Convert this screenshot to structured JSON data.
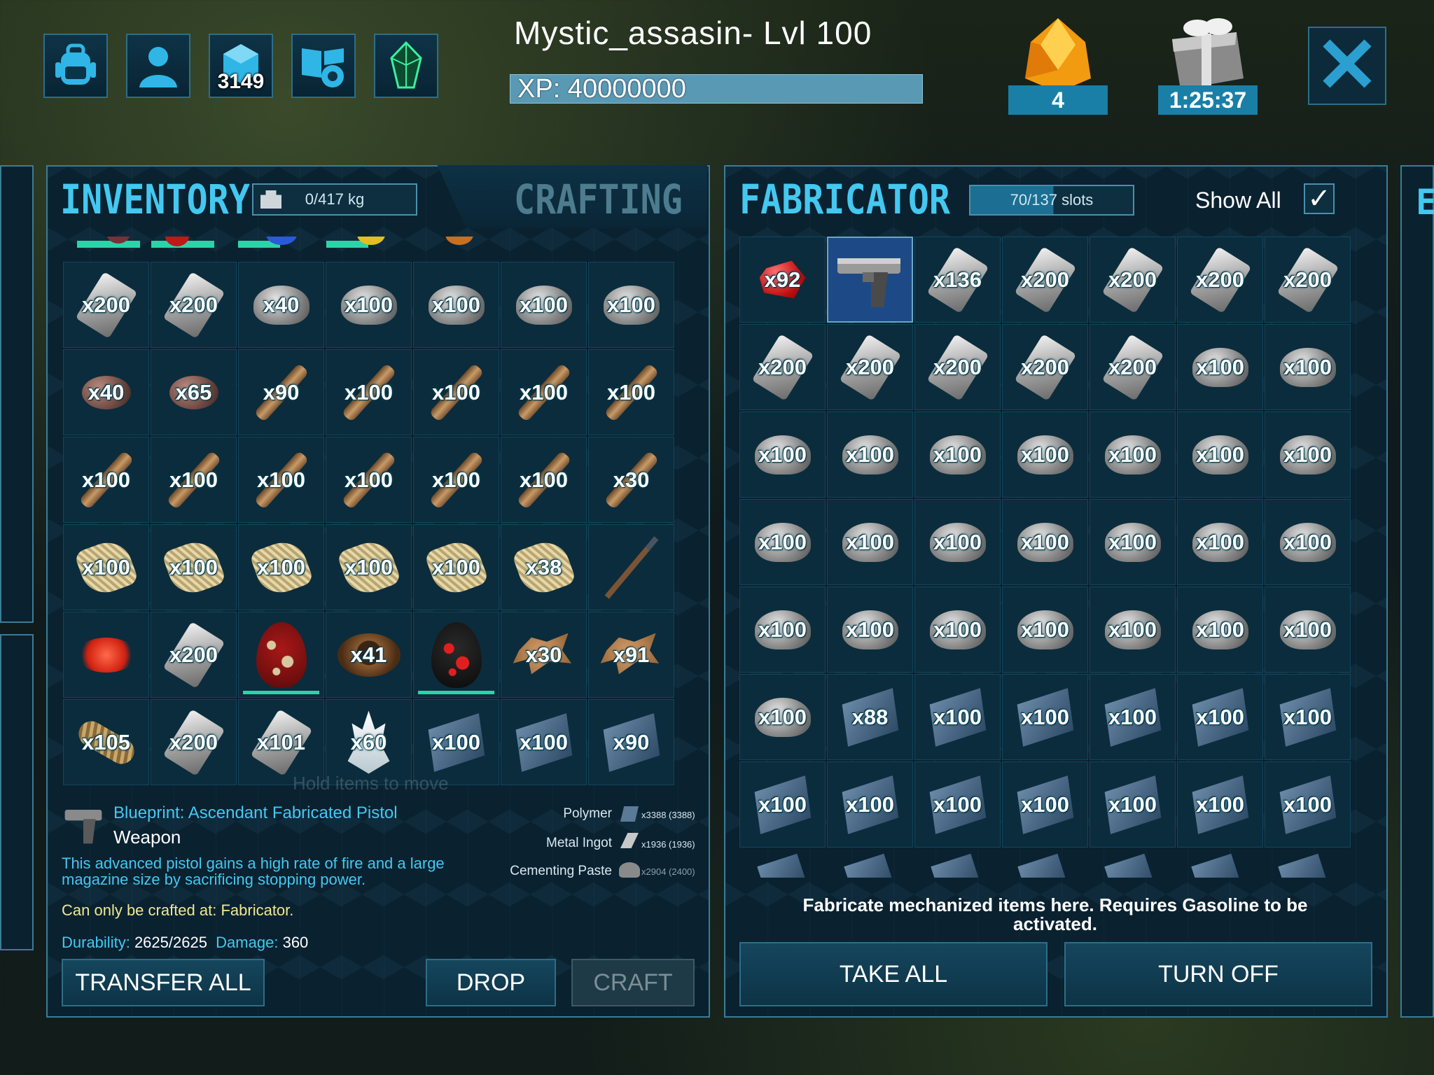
{
  "player": {
    "name": "Mystic_assasin- Lvl 100",
    "xp": "XP: 40000000"
  },
  "topbar": {
    "icons": [
      "backpack-icon",
      "character-icon",
      "engram-icon",
      "settings-book-icon",
      "tribe-crystal-icon"
    ],
    "engram_points": "3149",
    "resource_count": "4",
    "gift_timer": "1:25:37"
  },
  "inventory": {
    "title": "INVENTORY",
    "weight": "0/417 kg",
    "crafting_tab": "CRAFTING",
    "hint": "Hold items to move",
    "rows": [
      [
        {
          "k": "ingot",
          "q": "x200"
        },
        {
          "k": "ingot",
          "q": "x200"
        },
        {
          "k": "stone",
          "q": "x40"
        },
        {
          "k": "stone",
          "q": "x100"
        },
        {
          "k": "stone",
          "q": "x100"
        },
        {
          "k": "stone",
          "q": "x100"
        },
        {
          "k": "stone",
          "q": "x100"
        }
      ],
      [
        {
          "k": "flint",
          "q": "x40"
        },
        {
          "k": "flint",
          "q": "x65"
        },
        {
          "k": "wood",
          "q": "x90"
        },
        {
          "k": "wood",
          "q": "x100"
        },
        {
          "k": "wood",
          "q": "x100"
        },
        {
          "k": "wood",
          "q": "x100"
        },
        {
          "k": "wood",
          "q": "x100"
        }
      ],
      [
        {
          "k": "wood",
          "q": "x100"
        },
        {
          "k": "wood",
          "q": "x100"
        },
        {
          "k": "wood",
          "q": "x100"
        },
        {
          "k": "wood",
          "q": "x100"
        },
        {
          "k": "wood",
          "q": "x100"
        },
        {
          "k": "wood",
          "q": "x100"
        },
        {
          "k": "wood",
          "q": "x30"
        }
      ],
      [
        {
          "k": "thatch",
          "q": "x100"
        },
        {
          "k": "thatch",
          "q": "x100"
        },
        {
          "k": "thatch",
          "q": "x100"
        },
        {
          "k": "thatch",
          "q": "x100"
        },
        {
          "k": "thatch",
          "q": "x100"
        },
        {
          "k": "thatch",
          "q": "x38"
        },
        {
          "k": "spear",
          "q": ""
        }
      ],
      [
        {
          "k": "powder",
          "q": ""
        },
        {
          "k": "ingot",
          "q": "x200"
        },
        {
          "k": "egg",
          "q": "",
          "bar": true
        },
        {
          "k": "bowl",
          "q": "x41"
        },
        {
          "k": "egg2",
          "q": "",
          "bar": true
        },
        {
          "k": "hide",
          "q": "x30"
        },
        {
          "k": "hide",
          "q": "x91"
        }
      ],
      [
        {
          "k": "fiber",
          "q": "x105"
        },
        {
          "k": "ingot",
          "q": "x200"
        },
        {
          "k": "ingot",
          "q": "x101"
        },
        {
          "k": "crystal",
          "q": "x60"
        },
        {
          "k": "plate",
          "q": "x100"
        },
        {
          "k": "plate",
          "q": "x100"
        },
        {
          "k": "plate",
          "q": "x90"
        }
      ]
    ]
  },
  "item_detail": {
    "name": "Blueprint: Ascendant Fabricated Pistol",
    "type": "Weapon",
    "description": "This advanced pistol gains a high rate of fire and a large magazine size by sacrificing stopping power.",
    "crafted_at": "Can only be crafted at: Fabricator.",
    "durability_label": "Durability:",
    "durability": "2625/2625",
    "damage_label": "Damage:",
    "damage": "360",
    "requirements": [
      {
        "name": "Polymer",
        "amount": "x3388 (3388)"
      },
      {
        "name": "Metal Ingot",
        "amount": "x1936 (1936)"
      },
      {
        "name": "Cementing Paste",
        "amount": "x2904 (2400)"
      }
    ]
  },
  "inventory_buttons": {
    "transfer_all": "TRANSFER ALL",
    "drop": "DROP",
    "craft": "CRAFT"
  },
  "fabricator": {
    "title": "FABRICATOR",
    "slots": "70/137 slots",
    "show_all": "Show All",
    "show_all_checked": "✓",
    "info": "Fabricate mechanized items here. Requires Gasoline to be activated.",
    "take_all": "TAKE ALL",
    "turn_off": "TURN OFF",
    "rows": [
      [
        {
          "k": "gem-red",
          "q": "x92"
        },
        {
          "k": "pistol",
          "q": "",
          "sel": true
        },
        {
          "k": "ingot",
          "q": "x136"
        },
        {
          "k": "ingot",
          "q": "x200"
        },
        {
          "k": "ingot",
          "q": "x200"
        },
        {
          "k": "ingot",
          "q": "x200"
        },
        {
          "k": "ingot",
          "q": "x200"
        }
      ],
      [
        {
          "k": "ingot",
          "q": "x200"
        },
        {
          "k": "ingot",
          "q": "x200"
        },
        {
          "k": "ingot",
          "q": "x200"
        },
        {
          "k": "ingot",
          "q": "x200"
        },
        {
          "k": "ingot",
          "q": "x200"
        },
        {
          "k": "stone",
          "q": "x100"
        },
        {
          "k": "stone",
          "q": "x100"
        }
      ],
      [
        {
          "k": "stone",
          "q": "x100"
        },
        {
          "k": "stone",
          "q": "x100"
        },
        {
          "k": "stone",
          "q": "x100"
        },
        {
          "k": "stone",
          "q": "x100"
        },
        {
          "k": "stone",
          "q": "x100"
        },
        {
          "k": "stone",
          "q": "x100"
        },
        {
          "k": "stone",
          "q": "x100"
        }
      ],
      [
        {
          "k": "stone",
          "q": "x100"
        },
        {
          "k": "stone",
          "q": "x100"
        },
        {
          "k": "stone",
          "q": "x100"
        },
        {
          "k": "stone",
          "q": "x100"
        },
        {
          "k": "stone",
          "q": "x100"
        },
        {
          "k": "stone",
          "q": "x100"
        },
        {
          "k": "stone",
          "q": "x100"
        }
      ],
      [
        {
          "k": "stone",
          "q": "x100"
        },
        {
          "k": "stone",
          "q": "x100"
        },
        {
          "k": "stone",
          "q": "x100"
        },
        {
          "k": "stone",
          "q": "x100"
        },
        {
          "k": "stone",
          "q": "x100"
        },
        {
          "k": "stone",
          "q": "x100"
        },
        {
          "k": "stone",
          "q": "x100"
        }
      ],
      [
        {
          "k": "stone",
          "q": "x100"
        },
        {
          "k": "plate",
          "q": "x88"
        },
        {
          "k": "plate",
          "q": "x100"
        },
        {
          "k": "plate",
          "q": "x100"
        },
        {
          "k": "plate",
          "q": "x100"
        },
        {
          "k": "plate",
          "q": "x100"
        },
        {
          "k": "plate",
          "q": "x100"
        }
      ],
      [
        {
          "k": "plate",
          "q": "x100"
        },
        {
          "k": "plate",
          "q": "x100"
        },
        {
          "k": "plate",
          "q": "x100"
        },
        {
          "k": "plate",
          "q": "x100"
        },
        {
          "k": "plate",
          "q": "x100"
        },
        {
          "k": "plate",
          "q": "x100"
        },
        {
          "k": "plate",
          "q": "x100"
        }
      ]
    ]
  },
  "colors": {
    "accent": "#2a9fd0",
    "title": "#44c8f0",
    "durability_bar": "#2bd4a8",
    "selected_slot": "#1d4a86"
  }
}
